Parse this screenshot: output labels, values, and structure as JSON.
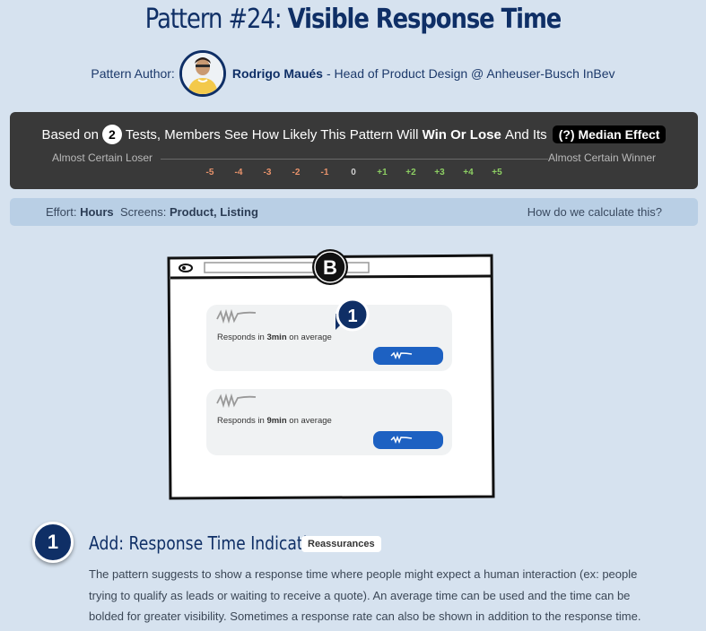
{
  "header": {
    "title_prefix": "Pattern #24: ",
    "title_name": "Visible Response Time",
    "author_label": "Pattern Author:",
    "author_name": "Rodrigo Maués",
    "author_role": "- Head of Product Design @ Anheuser-Busch InBev"
  },
  "likelihood": {
    "based_on": "Based on",
    "tests_count": "2",
    "text_mid": "Tests, Members See How Likely This Pattern Will",
    "win_or_lose": "Win Or Lose",
    "and_its": "And Its",
    "median_effect": "(?) Median Effect",
    "left_label": "Almost Certain Loser",
    "right_label": "Almost Certain Winner",
    "ticks": [
      "-5",
      "-4",
      "-3",
      "-2",
      "-1",
      "0",
      "+1",
      "+2",
      "+3",
      "+4",
      "+5"
    ],
    "colors": {
      "negative": "#e8926b",
      "zero": "#cfcfcf",
      "positive": "#8dcf63"
    }
  },
  "info": {
    "effort_label": "Effort:",
    "effort_value": "Hours",
    "screens_label": "Screens:",
    "screens_value": "Product, Listing",
    "calc_link": "How do we calculate this?"
  },
  "illustration": {
    "variant": "B",
    "marker": "1",
    "cards": [
      {
        "prefix": "Responds in ",
        "time": "3min",
        "suffix": " on average"
      },
      {
        "prefix": "Responds in ",
        "time": "9min",
        "suffix": " on average"
      }
    ]
  },
  "step": {
    "number": "1",
    "title": "Add: Response Time Indication",
    "tag": "Reassurances",
    "description": "The pattern suggests to show a response time where people might expect a human interaction (ex: people trying to qualify as leads or waiting to receive a quote). An average time can be used and the time can be bolded for greater visibility. Sometimes a response rate can also be shown in addition to the response time."
  }
}
